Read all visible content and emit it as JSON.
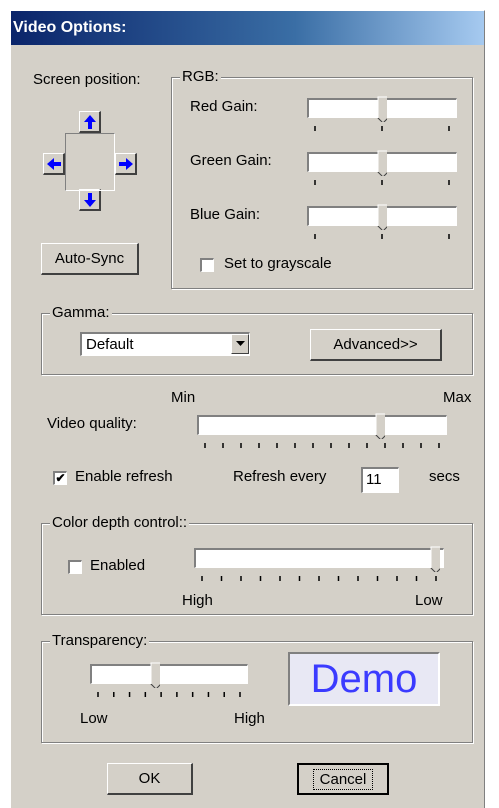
{
  "window": {
    "title": "Video Options:"
  },
  "screen_position": {
    "label": "Screen position:",
    "auto_sync_label": "Auto-Sync"
  },
  "rgb": {
    "title": "RGB:",
    "red_label": "Red Gain:",
    "red_value": 0.5,
    "green_label": "Green Gain:",
    "green_value": 0.5,
    "blue_label": "Blue Gain:",
    "blue_value": 0.5,
    "grayscale_label": "Set to grayscale",
    "grayscale_checked": false
  },
  "gamma": {
    "title": "Gamma:",
    "selected": "Default",
    "advanced_label": "Advanced>>"
  },
  "video_quality": {
    "label": "Video quality:",
    "min_label": "Min",
    "max_label": "Max",
    "value": 0.75
  },
  "refresh": {
    "enable_label": "Enable refresh",
    "enabled": true,
    "every_label": "Refresh every",
    "value": "11",
    "unit": "secs"
  },
  "color_depth": {
    "title": "Color depth control::",
    "enabled_label": "Enabled",
    "enabled": false,
    "high_label": "High",
    "low_label": "Low",
    "value": 1.0
  },
  "transparency": {
    "title": "Transparency:",
    "low_label": "Low",
    "high_label": "High",
    "value": 0.4,
    "demo_text": "Demo"
  },
  "buttons": {
    "ok_label": "OK",
    "cancel_label": "Cancel"
  },
  "colors": {
    "arrow": "#0000ff",
    "demo_text": "#3b3bff",
    "demo_bg": "#e8e8f4"
  }
}
